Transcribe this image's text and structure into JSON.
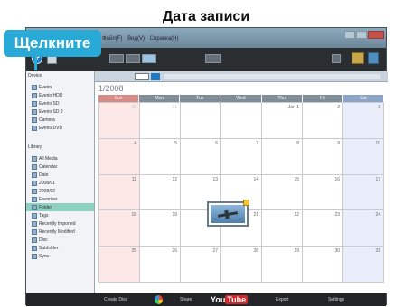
{
  "annotation": {
    "date_label": "Дата записи",
    "click_label": "Щелкните"
  },
  "menubar": [
    "Файл(F)",
    "Вид(V)",
    "Справка(H)"
  ],
  "sidebar": {
    "devices_header": "Device",
    "devices": [
      "Everio",
      "Everio HDD",
      "Everio SD",
      "Everio SD 2",
      "Camera",
      "Everio DVD"
    ],
    "library_header": "Library",
    "library": [
      "All Media",
      "Calendar",
      "Date",
      "2008/01",
      "2008/02",
      "Favorites",
      "Folder",
      "Tags",
      "Recently Imported",
      "Recently Modified",
      "Disc",
      "Subfolder",
      "Sync"
    ]
  },
  "calendar": {
    "month": "1/2008",
    "days": [
      "Sun",
      "Mon",
      "Tue",
      "Wed",
      "Thu",
      "Fri",
      "Sat"
    ],
    "weeks": [
      [
        "30",
        "31",
        "",
        "",
        "Jan 1",
        "2",
        "3"
      ],
      [
        "4",
        "5",
        "6",
        "7",
        "8",
        "9",
        "10"
      ],
      [
        "11",
        "12",
        "13",
        "14",
        "15",
        "16",
        "17"
      ],
      [
        "18",
        "19",
        "20",
        "21",
        "22",
        "23",
        "24"
      ],
      [
        "25",
        "26",
        "27",
        "28",
        "29",
        "30",
        "31"
      ]
    ]
  },
  "bottom": {
    "create_disc": "Create Disc",
    "share": "Share",
    "youtube": "YouTube",
    "youtube_you": "You",
    "youtube_tube": "Tube",
    "export": "Export",
    "settings": "Settings"
  },
  "colors": {
    "accent": "#29a9d6",
    "sunday": "#fde8e8",
    "saturday": "#eaeefa"
  }
}
